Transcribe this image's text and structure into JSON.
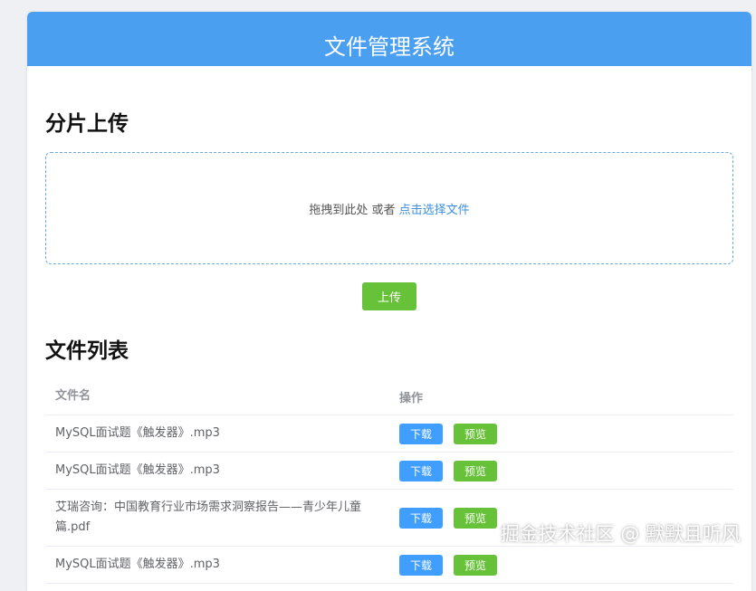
{
  "app": {
    "title": "文件管理系统"
  },
  "upload": {
    "section_title": "分片上传",
    "drop_hint": "拖拽到此处 或者",
    "pick_link": "点击选择文件",
    "upload_button": "上传"
  },
  "files": {
    "section_title": "文件列表",
    "columns": {
      "name": "文件名",
      "actions": "操作"
    },
    "rows": [
      {
        "name": "MySQL面试题《触发器》.mp3",
        "download": "下载",
        "preview": "预览"
      },
      {
        "name": "MySQL面试题《触发器》.mp3",
        "download": "下载",
        "preview": "预览"
      },
      {
        "name": "艾瑞咨询：中国教育行业市场需求洞察报告——青少年儿童篇.pdf",
        "download": "下载",
        "preview": "预览"
      },
      {
        "name": "MySQL面试题《触发器》.mp3",
        "download": "下载",
        "preview": "预览"
      }
    ]
  },
  "watermark": "掘金技术社区 @ 默默且听风",
  "colors": {
    "header": "#4b9ff0",
    "download_button": "#409eff",
    "preview_button": "#67c23a",
    "upload_button": "#67c23a",
    "link": "#3c8fe0"
  }
}
